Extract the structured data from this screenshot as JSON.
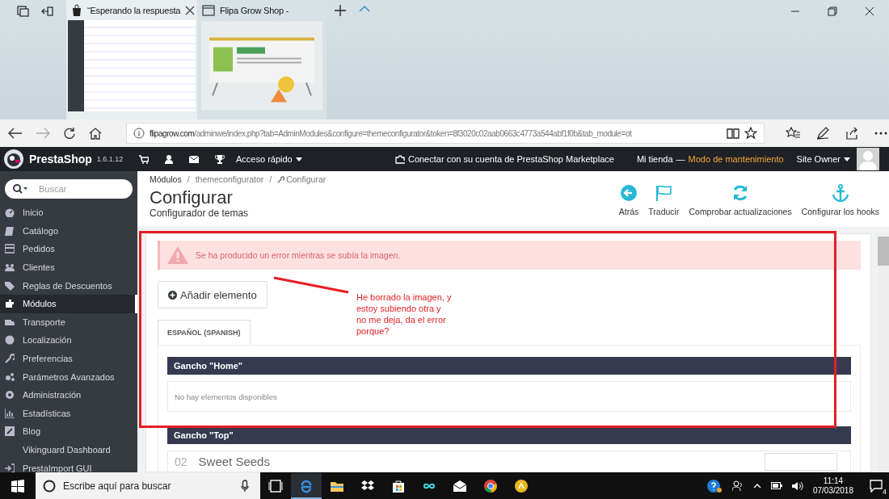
{
  "browser": {
    "tabs": [
      {
        "title": "“Esperando la respuesta",
        "selected": true,
        "kind": "admin"
      },
      {
        "title": "Flipa Grow Shop -",
        "selected": false,
        "kind": "maintenance"
      }
    ],
    "address": {
      "host": "flipagrow.com",
      "path": "/adminwe/index.php?tab=AdminModules&configure=themeconfigurator&token=8f3020c02aab0663c4773a544abf1f0b&tab_module=ot"
    }
  },
  "header": {
    "logo": "PrestaShop",
    "version": "1.6.1.12",
    "quick_access": "Acceso rápido",
    "marketplace": "Conectar con su cuenta de PrestaShop Marketplace",
    "shop": "Mi tienda",
    "separator": "—",
    "maintenance": "Modo de mantenimiento",
    "user": "Site Owner"
  },
  "sidebar": {
    "search": {
      "placeholder": "Buscar"
    },
    "items": [
      {
        "label": "Inicio",
        "selected": false
      },
      {
        "label": "Catálogo",
        "selected": false
      },
      {
        "label": "Pedidos",
        "selected": false
      },
      {
        "label": "Clientes",
        "selected": false
      },
      {
        "label": "Reglas de Descuentos",
        "selected": false
      },
      {
        "label": "Módulos",
        "selected": true
      },
      {
        "label": "Transporte",
        "selected": false
      },
      {
        "label": "Localización",
        "selected": false
      },
      {
        "label": "Preferencias",
        "selected": false
      },
      {
        "label": "Parámetros Avanzados",
        "selected": false
      },
      {
        "label": "Administración",
        "selected": false
      },
      {
        "label": "Estadísticas",
        "selected": false
      },
      {
        "label": "Blog",
        "selected": false
      },
      {
        "label": "Vikinguard Dashboard",
        "selected": false
      },
      {
        "label": "PrestaImport GUI",
        "selected": false
      }
    ]
  },
  "page": {
    "breadcrumb": [
      "Módulos",
      "/",
      "themeconfigurator",
      "/",
      "Configurar"
    ],
    "title": "Configurar",
    "subtitle": "Configurador de temas",
    "toolbar": [
      "Atrás",
      "Traducir",
      "Comprobar actualizaciones",
      "Configurar los hooks"
    ],
    "alert": "Se ha producido un error mientras se subía la imagen.",
    "add_button": "Añadir elemento",
    "language_tabs": [
      {
        "label": "ESPAÑOL (SPANISH)",
        "selected": true
      }
    ],
    "hooks": [
      {
        "title": "Gancho \"Home\"",
        "empty": "No hay elementos disponibles"
      },
      {
        "title": "Gancho \"Top\"",
        "items": [
          {
            "number": "02",
            "name": "Sweet Seeds"
          }
        ]
      }
    ]
  },
  "annotation": {
    "text": "He borrado la imagen, y estoy subiendo otra y no me deja, da el error porque?"
  },
  "taskbar": {
    "search": {
      "placeholder": "Escribe aquí para buscar"
    },
    "time": "11:14",
    "date": "07/03/2018",
    "notifications": "4"
  }
}
